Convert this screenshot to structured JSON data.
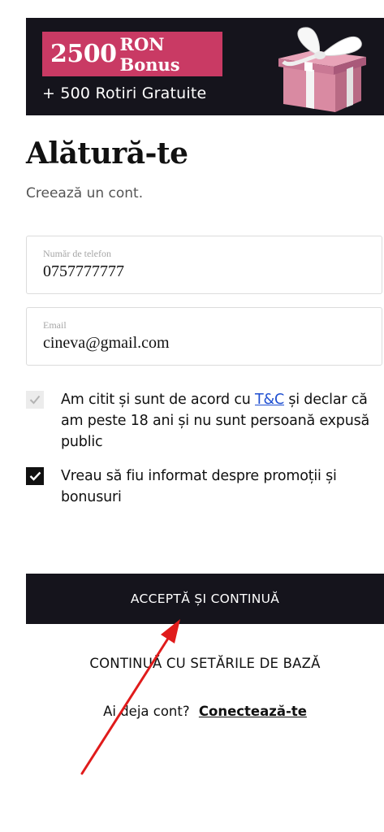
{
  "banner": {
    "amount": "2500",
    "bonus_label": "RON Bonus",
    "spins": "+ 500 Rotiri Gratuite",
    "colors": {
      "background": "#15141c",
      "pill": "#c93a64"
    }
  },
  "header": {
    "title": "Alătură-te",
    "subtitle": "Creează un cont."
  },
  "form": {
    "phone": {
      "label": "Număr de telefon",
      "value": "0757777777"
    },
    "email": {
      "label": "Email",
      "value": "cineva@gmail.com"
    },
    "terms": {
      "text_before": "Am citit și sunt de acord cu ",
      "link": "T&C",
      "text_after": " și declar că am peste 18 ani și nu sunt persoană expusă public",
      "checked": true,
      "disabled": true
    },
    "promos": {
      "text": "Vreau să fiu informat despre promoții și bonusuri",
      "checked": true
    }
  },
  "actions": {
    "accept_label": "ACCEPTĂ ȘI CONTINUĂ",
    "basic_label": "CONTINUĂ CU SETĂRILE DE BAZĂ",
    "have_account": "Ai deja cont?",
    "login_link": "Conectează-te"
  },
  "annotation": {
    "arrow_color": "#e01b1b"
  }
}
